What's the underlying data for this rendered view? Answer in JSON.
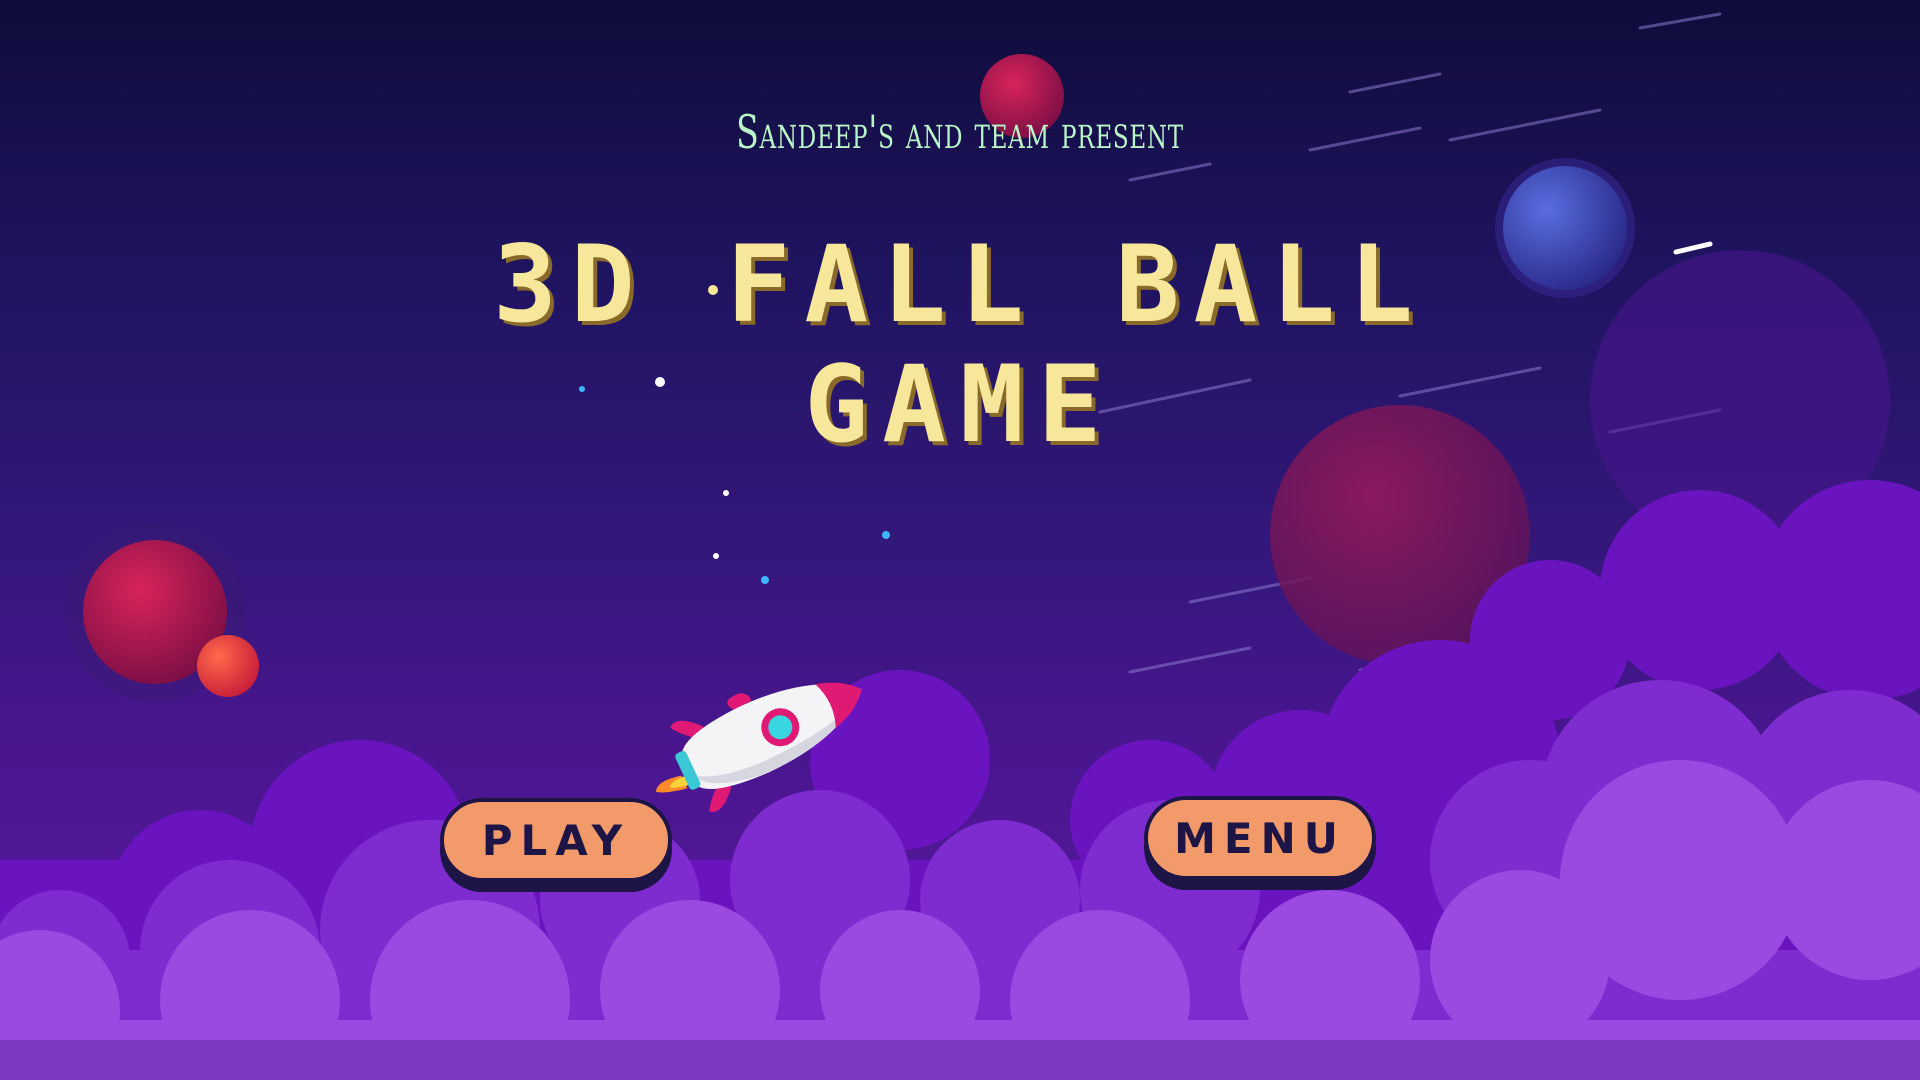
{
  "screen": {
    "subtitle": "Sandeep's and team present",
    "title_line1": "3D FALL BALL",
    "title_line2": "GAME"
  },
  "buttons": {
    "play_label": "PLAY",
    "menu_label": "MENU"
  },
  "colors": {
    "title": "#f6e79a",
    "subtitle": "#b9f5c6",
    "button_fill": "#f39a6b",
    "button_text": "#1e1547"
  },
  "icons": [
    "rocket-icon",
    "planet-icon",
    "star-icon",
    "cloud-icon"
  ]
}
